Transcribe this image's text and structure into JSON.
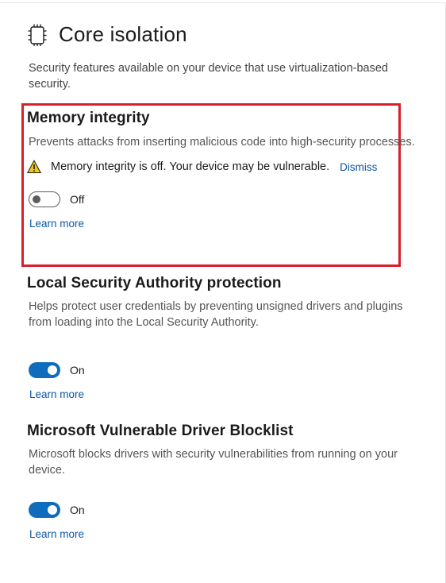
{
  "page": {
    "title": "Core isolation",
    "description": "Security features available on your device that use virtualization-based security.",
    "icon": "core-isolation-chip-icon"
  },
  "sections": [
    {
      "title": "Memory integrity",
      "description": "Prevents attacks from inserting malicious code into high-security processes.",
      "warning": {
        "icon": "warning-icon",
        "text": "Memory integrity is off. Your device may be vulnerable.",
        "dismiss_label": "Dismiss",
        "color": "#f2c811"
      },
      "toggle": {
        "state": "off",
        "label": "Off"
      },
      "learn_more": "Learn more",
      "highlighted": true,
      "highlight_color": "#d6202a"
    },
    {
      "title": "Local Security Authority protection",
      "description": "Helps protect user credentials by preventing unsigned drivers and plugins from loading into the Local Security Authority.",
      "toggle": {
        "state": "on",
        "label": "On"
      },
      "learn_more": "Learn more"
    },
    {
      "title": "Microsoft Vulnerable Driver Blocklist",
      "description": "Microsoft blocks drivers with security vulnerabilities from running on your device.",
      "toggle": {
        "state": "on",
        "label": "On"
      },
      "learn_more": "Learn more"
    }
  ],
  "colors": {
    "accent": "#0f6cbd",
    "link": "#0b57a4"
  }
}
